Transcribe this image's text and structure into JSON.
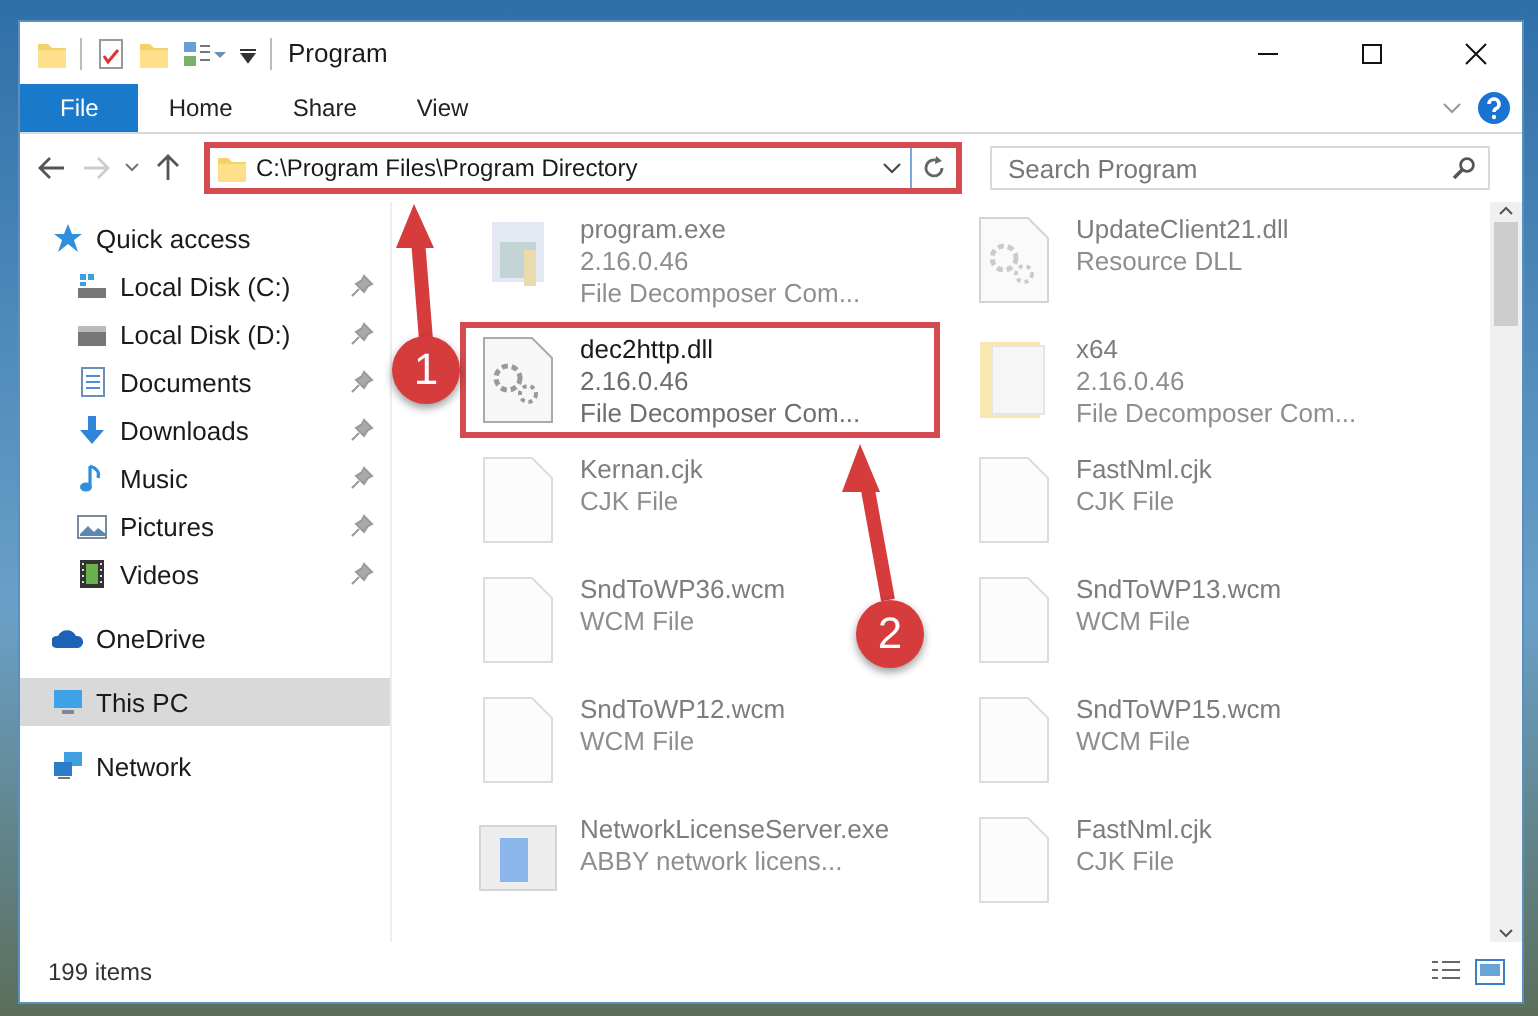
{
  "window": {
    "title": "Program"
  },
  "ribbon_tabs": [
    {
      "label": "File",
      "selected": true
    },
    {
      "label": "Home",
      "selected": false
    },
    {
      "label": "Share",
      "selected": false
    },
    {
      "label": "View",
      "selected": false
    }
  ],
  "address": {
    "path": "C:\\Program Files\\Program Directory",
    "highlighted": true
  },
  "search": {
    "placeholder": "Search Program"
  },
  "nav": [
    {
      "label": "Quick access",
      "kind": "star",
      "selected": false,
      "children": [
        {
          "label": "Local Disk (C:)",
          "kind": "system-drive",
          "pinned": true,
          "selected": false
        },
        {
          "label": "Local Disk (D:)",
          "kind": "drive",
          "pinned": true,
          "selected": false
        },
        {
          "label": "Documents",
          "kind": "documents",
          "pinned": true,
          "selected": false
        },
        {
          "label": "Downloads",
          "kind": "downloads",
          "pinned": true,
          "selected": false
        },
        {
          "label": "Music",
          "kind": "music",
          "pinned": true,
          "selected": false
        },
        {
          "label": "Pictures",
          "kind": "pictures",
          "pinned": true,
          "selected": false
        },
        {
          "label": "Videos",
          "kind": "videos",
          "pinned": true,
          "selected": false
        }
      ]
    },
    {
      "label": "OneDrive",
      "kind": "cloud",
      "selected": false
    },
    {
      "label": "This PC",
      "kind": "pc",
      "selected": true
    },
    {
      "label": "Network",
      "kind": "network",
      "selected": false
    }
  ],
  "files": [
    {
      "name": "program.exe",
      "lines": [
        "2.16.0.46",
        "File Decomposer Com..."
      ],
      "kind": "exe",
      "faded": true,
      "highlighted": false
    },
    {
      "name": "UpdateClient21.dll",
      "lines": [
        "Resource DLL"
      ],
      "kind": "dll",
      "faded": true,
      "highlighted": false
    },
    {
      "name": "dec2http.dll",
      "lines": [
        "2.16.0.46",
        "File Decomposer Com..."
      ],
      "kind": "dll",
      "faded": false,
      "highlighted": true
    },
    {
      "name": "x64",
      "lines": [
        "2.16.0.46",
        "File Decomposer Com..."
      ],
      "kind": "folder",
      "faded": true,
      "highlighted": false
    },
    {
      "name": "Kernan.cjk",
      "lines": [
        "CJK File"
      ],
      "kind": "blank",
      "faded": true,
      "highlighted": false
    },
    {
      "name": "FastNml.cjk",
      "lines": [
        "CJK File"
      ],
      "kind": "blank",
      "faded": true,
      "highlighted": false
    },
    {
      "name": "SndToWP36.wcm",
      "lines": [
        "WCM File"
      ],
      "kind": "blank",
      "faded": true,
      "highlighted": false
    },
    {
      "name": "SndToWP13.wcm",
      "lines": [
        "WCM File"
      ],
      "kind": "blank",
      "faded": true,
      "highlighted": false
    },
    {
      "name": "SndToWP12.wcm",
      "lines": [
        "WCM File"
      ],
      "kind": "blank",
      "faded": true,
      "highlighted": false
    },
    {
      "name": "SndToWP15.wcm",
      "lines": [
        "WCM File"
      ],
      "kind": "blank",
      "faded": true,
      "highlighted": false
    },
    {
      "name": "NetworkLicenseServer.exe",
      "lines": [
        "ABBY network licens..."
      ],
      "kind": "app",
      "faded": true,
      "highlighted": false
    },
    {
      "name": "FastNml.cjk",
      "lines": [
        "CJK File"
      ],
      "kind": "blank",
      "faded": true,
      "highlighted": false
    }
  ],
  "status_bar": {
    "count": "199 items"
  },
  "annotations": [
    {
      "label": "1"
    },
    {
      "label": "2"
    }
  ]
}
